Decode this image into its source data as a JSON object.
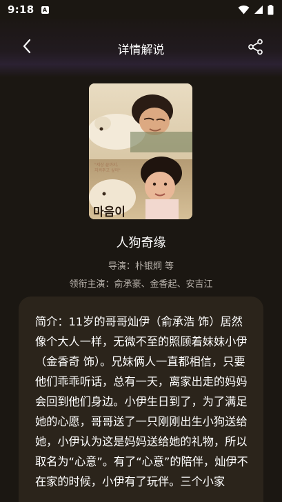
{
  "status_bar": {
    "time": "9:18",
    "app_badge": "A",
    "icons": [
      "wifi-icon",
      "signal-icon",
      "battery-icon"
    ]
  },
  "header": {
    "title": "详情解说",
    "back_icon": "chevron-left-icon",
    "share_icon": "share-icon"
  },
  "movie": {
    "poster_text": "마음이",
    "title": "人狗奇缘",
    "director": "导演：朴银炯 等",
    "cast": "领衔主演：俞承豪、金香起、安吉江"
  },
  "synopsis": {
    "text": "简介：11岁的哥哥灿伊（俞承浩 饰）居然像个大人一样，无微不至的照顾着妹妹小伊（金香奇 饰）。兄妹俩人一直都相信，只要他们乖乖听话，总有一天，离家出走的妈妈会回到他们身边。小伊生日到了，为了满足她的心愿，哥哥送了一只刚刚出生小狗送给她，小伊认为这是妈妈送给她的礼物，所以取名为“心意”。有了“心意”的陪伴，灿伊不在家的时候，小伊有了玩伴。三个小家"
  },
  "colors": {
    "background": "#1b1712",
    "card": "#2b241b",
    "muted_text": "#b8b2ab"
  }
}
